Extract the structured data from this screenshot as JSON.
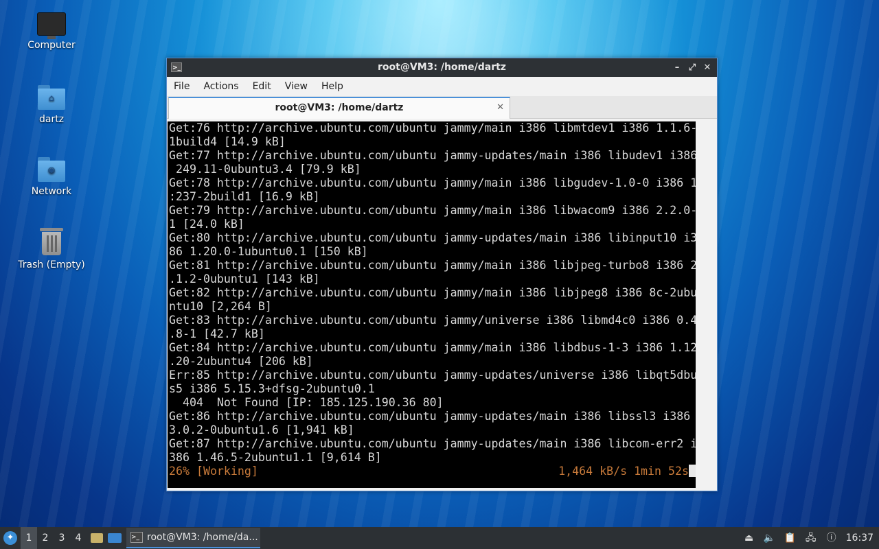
{
  "desktop": {
    "icons": [
      {
        "label": "Computer"
      },
      {
        "label": "dartz"
      },
      {
        "label": "Network"
      },
      {
        "label": "Trash (Empty)"
      }
    ]
  },
  "window": {
    "title": "root@VM3: /home/dartz",
    "menu": [
      "File",
      "Actions",
      "Edit",
      "View",
      "Help"
    ],
    "tab_label": "root@VM3: /home/dartz"
  },
  "terminal": {
    "lines": [
      "Get:76 http://archive.ubuntu.com/ubuntu jammy/main i386 libmtdev1 i386 1.1.6-",
      "1build4 [14.9 kB]",
      "Get:77 http://archive.ubuntu.com/ubuntu jammy-updates/main i386 libudev1 i386",
      " 249.11-0ubuntu3.4 [79.9 kB]",
      "Get:78 http://archive.ubuntu.com/ubuntu jammy/main i386 libgudev-1.0-0 i386 1",
      ":237-2build1 [16.9 kB]",
      "Get:79 http://archive.ubuntu.com/ubuntu jammy/main i386 libwacom9 i386 2.2.0-",
      "1 [24.0 kB]",
      "Get:80 http://archive.ubuntu.com/ubuntu jammy-updates/main i386 libinput10 i3",
      "86 1.20.0-1ubuntu0.1 [150 kB]",
      "Get:81 http://archive.ubuntu.com/ubuntu jammy/main i386 libjpeg-turbo8 i386 2",
      ".1.2-0ubuntu1 [143 kB]",
      "Get:82 http://archive.ubuntu.com/ubuntu jammy/main i386 libjpeg8 i386 8c-2ubu",
      "ntu10 [2,264 B]",
      "Get:83 http://archive.ubuntu.com/ubuntu jammy/universe i386 libmd4c0 i386 0.4",
      ".8-1 [42.7 kB]",
      "Get:84 http://archive.ubuntu.com/ubuntu jammy/main i386 libdbus-1-3 i386 1.12",
      ".20-2ubuntu4 [206 kB]",
      "Err:85 http://archive.ubuntu.com/ubuntu jammy-updates/universe i386 libqt5dbu",
      "s5 i386 5.15.3+dfsg-2ubuntu0.1",
      "  404  Not Found [IP: 185.125.190.36 80]",
      "Get:86 http://archive.ubuntu.com/ubuntu jammy-updates/main i386 libssl3 i386",
      "3.0.2-0ubuntu1.6 [1,941 kB]",
      "Get:87 http://archive.ubuntu.com/ubuntu jammy-updates/main i386 libcom-err2 i",
      "386 1.46.5-2ubuntu1.1 [9,614 B]"
    ],
    "status_left": "26% [Working]",
    "status_right": "1,464 kB/s 1min 52s"
  },
  "taskbar": {
    "workspaces": [
      "1",
      "2",
      "3",
      "4"
    ],
    "active_workspace": "1",
    "task_label": "root@VM3: /home/da...",
    "clock": "16:37"
  },
  "colors": {
    "terminal_bg": "#000000",
    "terminal_fg": "#d8d8d8",
    "status_fg": "#c87a3a",
    "accent": "#4a90d9",
    "taskbar_bg": "#2c3034"
  },
  "icons": {
    "computer": "monitor-icon",
    "home_folder": "home-folder-icon",
    "network": "network-folder-icon",
    "trash": "trash-icon"
  }
}
